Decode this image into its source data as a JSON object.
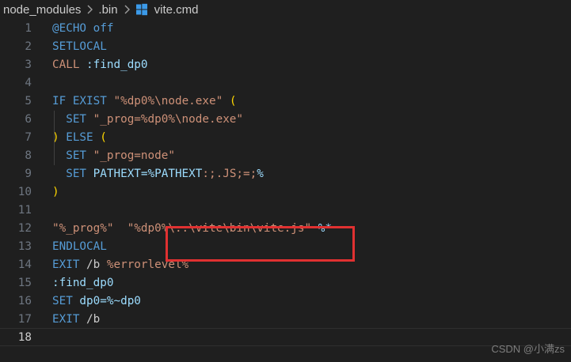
{
  "breadcrumb": {
    "items": [
      "node_modules",
      ".bin",
      "vite.cmd"
    ]
  },
  "editor": {
    "lines": [
      {
        "number": "1",
        "tokens": [
          {
            "t": "@ECHO off",
            "c": "t-kw"
          }
        ]
      },
      {
        "number": "2",
        "tokens": [
          {
            "t": "SETLOCAL",
            "c": "t-kw"
          }
        ]
      },
      {
        "number": "3",
        "tokens": [
          {
            "t": "CALL",
            "c": "t-str"
          },
          {
            "t": " ",
            "c": "t-plain"
          },
          {
            "t": ":find_dp0",
            "c": "t-var"
          }
        ]
      },
      {
        "number": "4",
        "tokens": []
      },
      {
        "number": "5",
        "tokens": [
          {
            "t": "IF",
            "c": "t-kw"
          },
          {
            "t": " ",
            "c": "t-plain"
          },
          {
            "t": "EXIST",
            "c": "t-kw"
          },
          {
            "t": " \"%dp0%",
            "c": "t-str"
          },
          {
            "t": "\\node.exe\"",
            "c": "t-str"
          },
          {
            "t": " ",
            "c": "t-plain"
          },
          {
            "t": "(",
            "c": "t-paren"
          }
        ]
      },
      {
        "number": "6",
        "tokens": [
          {
            "t": "  ",
            "c": "t-plain"
          },
          {
            "t": "SET",
            "c": "t-kw"
          },
          {
            "t": " \"_prog=%dp0%\\node.exe\"",
            "c": "t-str"
          }
        ]
      },
      {
        "number": "7",
        "tokens": [
          {
            "t": ")",
            "c": "t-paren"
          },
          {
            "t": " ",
            "c": "t-plain"
          },
          {
            "t": "ELSE",
            "c": "t-kw"
          },
          {
            "t": " ",
            "c": "t-plain"
          },
          {
            "t": "(",
            "c": "t-paren"
          }
        ]
      },
      {
        "number": "8",
        "tokens": [
          {
            "t": "  ",
            "c": "t-plain"
          },
          {
            "t": "SET",
            "c": "t-kw"
          },
          {
            "t": " \"_prog=node\"",
            "c": "t-str"
          }
        ]
      },
      {
        "number": "9",
        "tokens": [
          {
            "t": "  ",
            "c": "t-plain"
          },
          {
            "t": "SET",
            "c": "t-kw"
          },
          {
            "t": " PATHEXT=",
            "c": "t-var"
          },
          {
            "t": "%PATHEXT",
            "c": "t-var"
          },
          {
            "t": ":;.JS;=;",
            "c": "t-str"
          },
          {
            "t": "%",
            "c": "t-var"
          }
        ]
      },
      {
        "number": "10",
        "tokens": [
          {
            "t": ")",
            "c": "t-paren"
          }
        ]
      },
      {
        "number": "11",
        "tokens": []
      },
      {
        "number": "12",
        "tokens": [
          {
            "t": "\"%_prog%\"",
            "c": "t-str"
          },
          {
            "t": "  ",
            "c": "t-plain"
          },
          {
            "t": "\"%dp0%",
            "c": "t-str"
          },
          {
            "t": "\\..\\vite\\bin\\vite.js\"",
            "c": "t-str"
          },
          {
            "t": " ",
            "c": "t-plain"
          },
          {
            "t": "%*",
            "c": "t-var"
          }
        ]
      },
      {
        "number": "13",
        "tokens": [
          {
            "t": "ENDLOCAL",
            "c": "t-kw"
          }
        ]
      },
      {
        "number": "14",
        "tokens": [
          {
            "t": "EXIT",
            "c": "t-kw"
          },
          {
            "t": " /b ",
            "c": "t-plain"
          },
          {
            "t": "%errorlevel%",
            "c": "t-str"
          }
        ]
      },
      {
        "number": "15",
        "tokens": [
          {
            "t": ":find_dp0",
            "c": "t-var"
          }
        ]
      },
      {
        "number": "16",
        "tokens": [
          {
            "t": "SET",
            "c": "t-kw"
          },
          {
            "t": " dp0=",
            "c": "t-var"
          },
          {
            "t": "%~dp0",
            "c": "t-var"
          }
        ]
      },
      {
        "number": "17",
        "tokens": [
          {
            "t": "EXIT",
            "c": "t-kw"
          },
          {
            "t": " /b",
            "c": "t-plain"
          }
        ]
      },
      {
        "number": "18",
        "tokens": [],
        "current": true
      }
    ]
  },
  "watermark": "CSDN @小满zs"
}
